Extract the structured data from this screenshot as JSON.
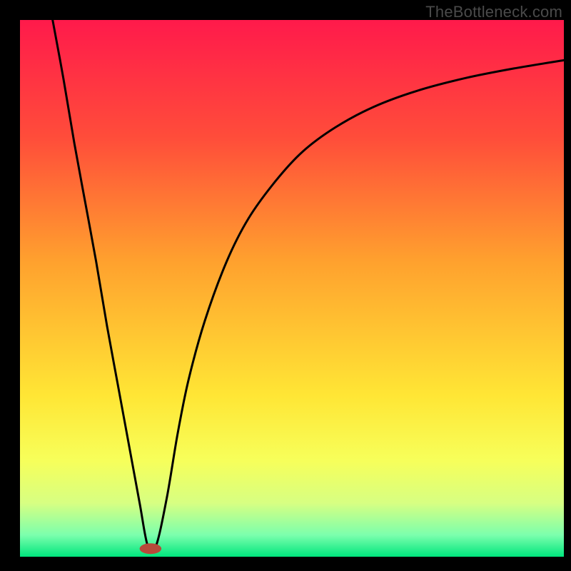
{
  "watermark": "TheBottleneck.com",
  "chart_data": {
    "type": "line",
    "title": "",
    "xlabel": "",
    "ylabel": "",
    "xlim": [
      0,
      100
    ],
    "ylim": [
      0,
      100
    ],
    "grid": false,
    "legend": false,
    "background_gradient": {
      "stops": [
        {
          "pos": 0.0,
          "color": "#ff1a4b"
        },
        {
          "pos": 0.22,
          "color": "#ff4d3a"
        },
        {
          "pos": 0.45,
          "color": "#ffa12e"
        },
        {
          "pos": 0.7,
          "color": "#ffe635"
        },
        {
          "pos": 0.82,
          "color": "#f7ff5a"
        },
        {
          "pos": 0.9,
          "color": "#d7ff82"
        },
        {
          "pos": 0.96,
          "color": "#7bffad"
        },
        {
          "pos": 1.0,
          "color": "#00e57d"
        }
      ]
    },
    "series": [
      {
        "name": "bottleneck-curve",
        "color": "#000000",
        "x": [
          6,
          8,
          10,
          12,
          14,
          16,
          18,
          20,
          22,
          23.5,
          25,
          27,
          29,
          31,
          34,
          38,
          42,
          47,
          52,
          58,
          65,
          73,
          82,
          91,
          100
        ],
        "y": [
          100,
          89,
          77,
          66,
          55,
          43,
          32,
          21,
          10,
          2,
          2,
          11,
          23,
          33,
          44,
          55,
          63,
          70,
          75.5,
          80,
          83.8,
          86.8,
          89.2,
          91,
          92.5
        ]
      }
    ],
    "marker": {
      "name": "min-point",
      "x": 24,
      "y": 1.5,
      "rx": 2.0,
      "ry": 1.0,
      "color": "#b74a3a"
    }
  }
}
